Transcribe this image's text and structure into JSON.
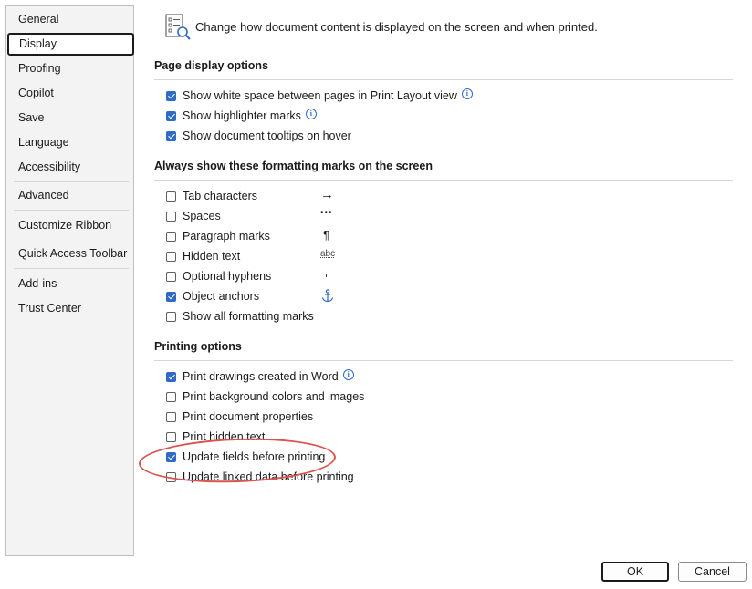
{
  "sidebar": {
    "items": [
      {
        "label": "General"
      },
      {
        "label": "Display",
        "selected": true
      },
      {
        "label": "Proofing"
      },
      {
        "label": "Copilot"
      },
      {
        "label": "Save"
      },
      {
        "label": "Language"
      },
      {
        "label": "Accessibility"
      },
      {
        "label": "Advanced"
      },
      {
        "label": "Customize Ribbon"
      },
      {
        "label": "Quick Access Toolbar"
      },
      {
        "label": "Add-ins"
      },
      {
        "label": "Trust Center"
      }
    ]
  },
  "header": {
    "text": "Change how document content is displayed on the screen and when printed.",
    "icon": "display-options-icon"
  },
  "page_display": {
    "title": "Page display options",
    "options": [
      {
        "label": "Show white space between pages in Print Layout view",
        "checked": true,
        "info": true
      },
      {
        "label": "Show highlighter marks",
        "checked": true,
        "info": true
      },
      {
        "label": "Show document tooltips on hover",
        "checked": true,
        "info": false
      }
    ]
  },
  "formatting_marks": {
    "title": "Always show these formatting marks on the screen",
    "options": [
      {
        "label": "Tab characters",
        "checked": false,
        "mark": "→"
      },
      {
        "label": "Spaces",
        "checked": false,
        "mark": "•••"
      },
      {
        "label": "Paragraph marks",
        "checked": false,
        "mark": "¶"
      },
      {
        "label": "Hidden text",
        "checked": false,
        "mark": "abc"
      },
      {
        "label": "Optional hyphens",
        "checked": false,
        "mark": "¬"
      },
      {
        "label": "Object anchors",
        "checked": true,
        "mark": "anchor-icon"
      },
      {
        "label": "Show all formatting marks",
        "checked": false,
        "mark": ""
      }
    ]
  },
  "printing": {
    "title": "Printing options",
    "options": [
      {
        "label": "Print drawings created in Word",
        "checked": true,
        "info": true
      },
      {
        "label": "Print background colors and images",
        "checked": false
      },
      {
        "label": "Print document properties",
        "checked": false
      },
      {
        "label": "Print hidden text",
        "checked": false
      },
      {
        "label": "Update fields before printing",
        "checked": true,
        "highlighted": true
      },
      {
        "label": "Update linked data before printing",
        "checked": false
      }
    ]
  },
  "buttons": {
    "ok_label": "OK",
    "cancel_label": "Cancel"
  },
  "colors": {
    "accent": "#2f6ac7",
    "highlight": "#d9534f"
  }
}
